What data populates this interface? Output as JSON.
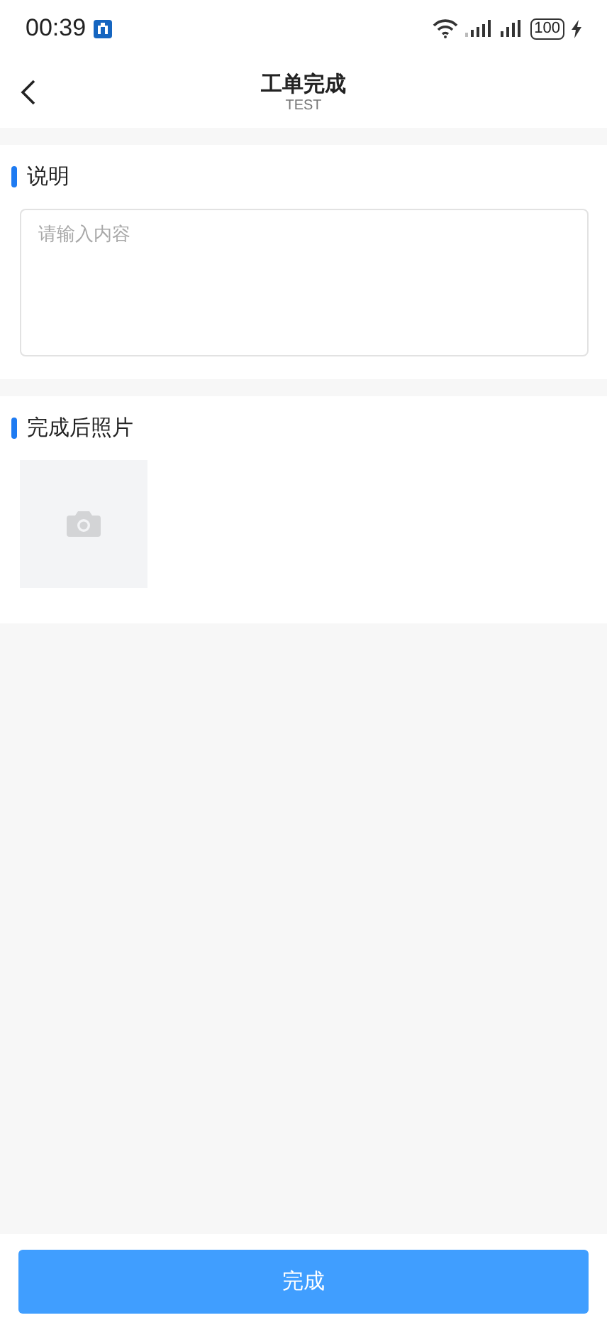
{
  "status_bar": {
    "time": "00:39",
    "battery": "100"
  },
  "header": {
    "title": "工单完成",
    "subtitle": "TEST"
  },
  "sections": [
    {
      "kind": "text",
      "title": "说明",
      "placeholder": "请输入内容"
    },
    {
      "kind": "photos",
      "title": "完成后照片"
    }
  ],
  "submit_button": {
    "label": "完成"
  }
}
